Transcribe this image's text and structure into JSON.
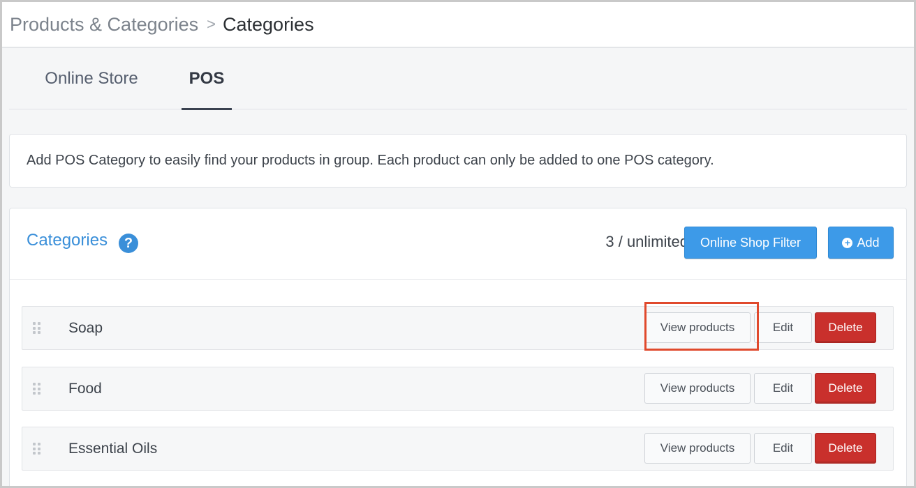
{
  "breadcrumb": {
    "parent": "Products & Categories",
    "separator": ">",
    "current": "Categories"
  },
  "tabs": [
    {
      "label": "Online Store",
      "active": false
    },
    {
      "label": "POS",
      "active": true
    }
  ],
  "info": {
    "text": "Add POS Category to easily find your products in group. Each product can only be added to one POS category."
  },
  "categories": {
    "title": "Categories",
    "help_icon": "question-circle-icon",
    "count": "3 / unlimited",
    "filter_label": "Online Shop Filter",
    "add_label": "Add",
    "items": [
      {
        "name": "Soap",
        "view_label": "View products",
        "edit_label": "Edit",
        "delete_label": "Delete"
      },
      {
        "name": "Food",
        "view_label": "View products",
        "edit_label": "Edit",
        "delete_label": "Delete"
      },
      {
        "name": "Essential Oils",
        "view_label": "View products",
        "edit_label": "Edit",
        "delete_label": "Delete"
      }
    ]
  },
  "colors": {
    "accent": "#3a8fd9",
    "button_blue": "#3d9ae8",
    "delete_red": "#c9302c",
    "highlight": "#e0492c"
  }
}
